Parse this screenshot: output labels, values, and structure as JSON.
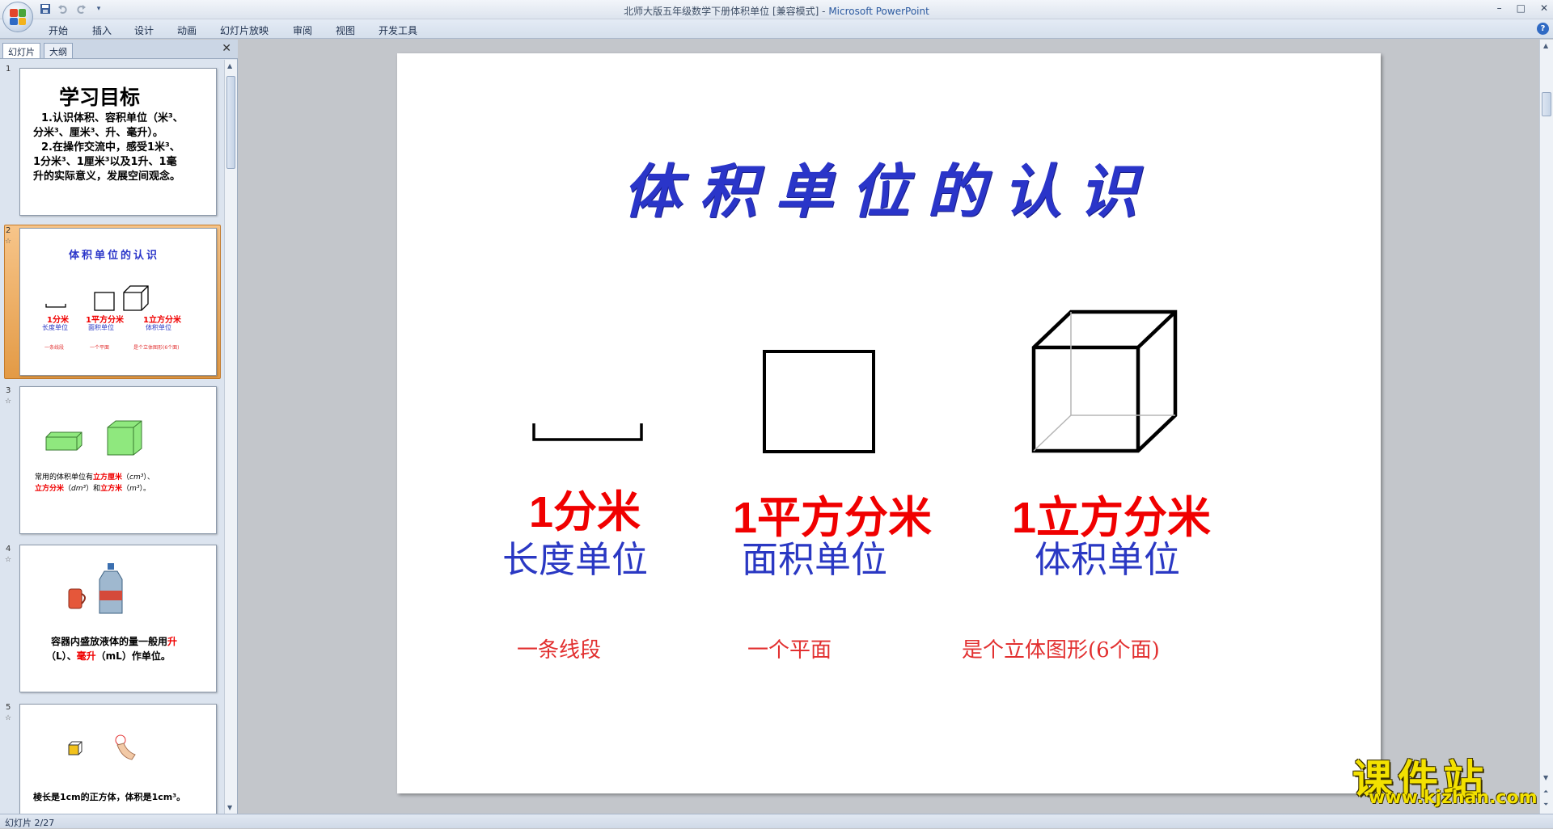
{
  "window": {
    "title_doc": "北师大版五年级数学下册体积单位 [兼容模式] - ",
    "title_app": "Microsoft PowerPoint",
    "controls": [
      "–",
      "□",
      "✕"
    ]
  },
  "ribbon_tabs": [
    "开始",
    "插入",
    "设计",
    "动画",
    "幻灯片放映",
    "审阅",
    "视图",
    "开发工具"
  ],
  "pane": {
    "tab_slides": "幻灯片",
    "tab_outline": "大纲",
    "close": "✕"
  },
  "thumbs": [
    {
      "num": "1",
      "title": "学习目标",
      "lines": [
        "1.认识体积、容积单位（米³、",
        "分米³、厘米³、升、毫升）。",
        "2.在操作交流中，感受1米³、",
        "1分米³、1厘米³以及1升、1毫",
        "升的实际意义，发展空间观念。"
      ]
    },
    {
      "num": "2",
      "title": "体积单位的认识",
      "labels": [
        "1分米",
        "1平方分米",
        "1立方分米"
      ],
      "units": [
        "长度单位",
        "面积单位",
        "体积单位"
      ],
      "descs": [
        "一条线段",
        "一个平面",
        "是个立体图形(6个面)"
      ]
    },
    {
      "num": "3",
      "line1": [
        "常用的体积单位有",
        "立方厘米",
        "（",
        "cm³",
        "）、"
      ],
      "line2": [
        "立方分米",
        "（",
        "dm³",
        "）和",
        "立方米",
        "（",
        "m³",
        "）。"
      ]
    },
    {
      "num": "4",
      "line1": [
        "容器内盛放液体的量一般用",
        "升"
      ],
      "line2": [
        "（L）、",
        "毫升",
        "（mL）作单位。"
      ]
    },
    {
      "num": "5",
      "line1": "棱长是1cm的正方体，体积是1cm³。"
    }
  ],
  "slide": {
    "title": "体积单位的认识",
    "items": [
      {
        "label": "1分米",
        "unit": "长度单位",
        "desc": "一条线段"
      },
      {
        "label": "1平方分米",
        "unit": "面积单位",
        "desc": "一个平面"
      },
      {
        "label": "1立方分米",
        "unit": "体积单位",
        "desc": "是个立体图形(6个面)"
      }
    ]
  },
  "status": {
    "text": "幻灯片 2/27"
  },
  "watermark": {
    "title": "课件站",
    "url": "www.kjzhan.com"
  },
  "colors": {
    "title_blue": "#2a35c9",
    "label_red": "#f00000",
    "unit_blue": "#2a38c3",
    "desc_red": "#e23030",
    "selection_orange": "#e39a45"
  },
  "icons": {
    "office": "office-button-icon",
    "save": "save-icon",
    "undo": "undo-icon",
    "redo": "redo-icon",
    "help": "help-icon"
  }
}
